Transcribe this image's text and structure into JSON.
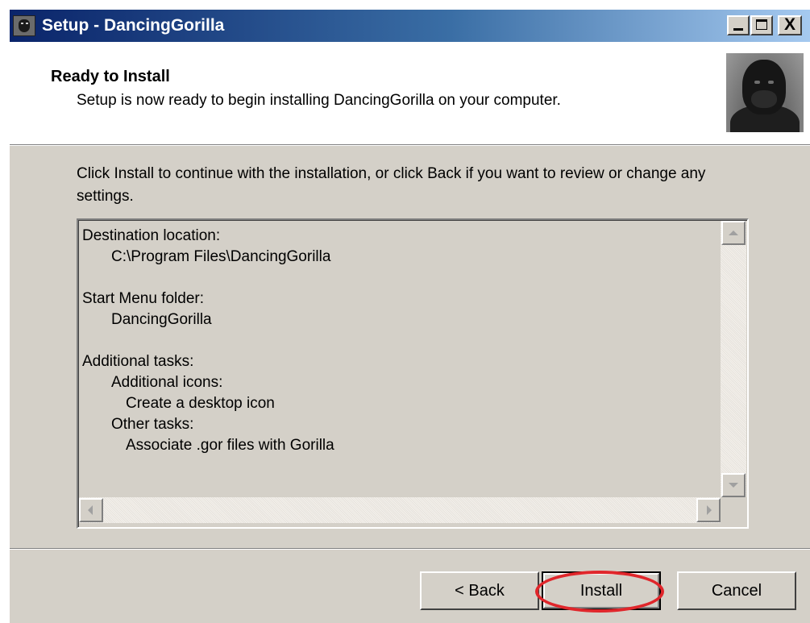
{
  "window": {
    "title": "Setup - DancingGorilla",
    "controls": {
      "minimize": "_",
      "maximize": "□",
      "close": "X"
    }
  },
  "header": {
    "title": "Ready to Install",
    "subtitle": "Setup is now ready to begin installing DancingGorilla on your computer."
  },
  "instruction": "Click Install to continue with the installation, or click Back if you want to review or change any settings.",
  "summary": {
    "lines": [
      {
        "text": "Destination location:"
      },
      {
        "text": "C:\\Program Files\\DancingGorilla"
      },
      {
        "text": "Start Menu folder:"
      },
      {
        "text": "DancingGorilla"
      },
      {
        "text": "Additional tasks:"
      },
      {
        "text": "Additional icons:"
      },
      {
        "text": "Create a desktop icon"
      },
      {
        "text": "Other tasks:"
      },
      {
        "text": "Associate .gor files with Gorilla"
      }
    ]
  },
  "buttons": {
    "back": "< Back",
    "install": "Install",
    "cancel": "Cancel"
  },
  "colors": {
    "highlight": "#e0262b",
    "titlebar_start": "#0a246a",
    "titlebar_end": "#a6caf0",
    "dialog_face": "#d4d0c8"
  }
}
